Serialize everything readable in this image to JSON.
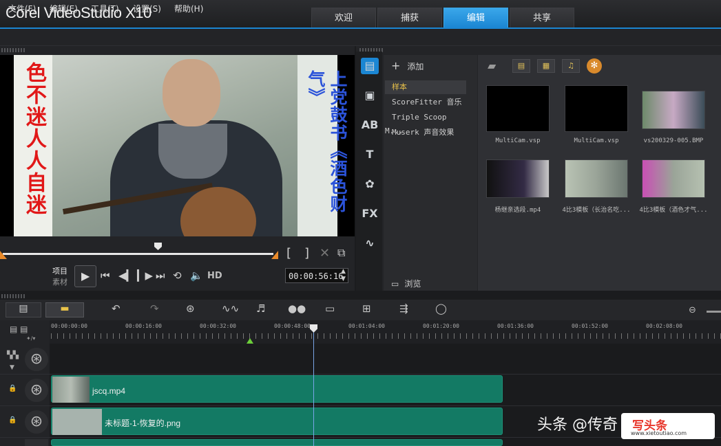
{
  "app": {
    "logo": "Corel VideoStudio X10"
  },
  "tabs": [
    {
      "label": "欢迎",
      "active": false
    },
    {
      "label": "捕获",
      "active": false
    },
    {
      "label": "编辑",
      "active": true
    },
    {
      "label": "共享",
      "active": false
    }
  ],
  "menu": [
    "文件(F)",
    "编辑(E)",
    "工具(T)",
    "设置(S)",
    "帮助(H)"
  ],
  "preview": {
    "left_text": "色不迷人人自迷",
    "right_text": "上党鼓书《酒色财气》",
    "project_label": "项目",
    "clip_label": "素材",
    "hd_label": "HD",
    "timecode": "00:00:56:16"
  },
  "library": {
    "add_label": "添加",
    "folders": [
      {
        "label": "样本",
        "selected": true
      },
      {
        "label": "ScoreFitter 音乐",
        "selected": false
      },
      {
        "label": "Triple Scoop M...",
        "selected": false
      },
      {
        "label": "Muserk 声音效果",
        "selected": false
      }
    ],
    "browse_label": "浏览",
    "items": [
      {
        "name": "MultiCam.vsp"
      },
      {
        "name": "MultiCam.vsp"
      },
      {
        "name": "vs200329-005.BMP"
      },
      {
        "name": "杨继亲选段.mp4"
      },
      {
        "name": "4比3模板（长治名吃..."
      },
      {
        "name": "4比3模板（酒色才气..."
      }
    ]
  },
  "timeline": {
    "ruler": [
      "00:00:00:00",
      "00:00:16:00",
      "00:00:32:00",
      "00:00:48:00",
      "00:01:04:00",
      "00:01:20:00",
      "00:01:36:00",
      "00:01:52:00",
      "00:02:08:00"
    ],
    "clips": [
      {
        "label": "jscq.mp4"
      },
      {
        "label": "未标题-1-恢复的.png"
      }
    ]
  },
  "watermark": {
    "text": "头条 @传奇",
    "logo_main": "写头条",
    "logo_sub": "www.xietoutiao.com"
  },
  "colors": {
    "accent": "#1b86d3",
    "clip": "#137a64",
    "marker": "#e98a2a"
  }
}
